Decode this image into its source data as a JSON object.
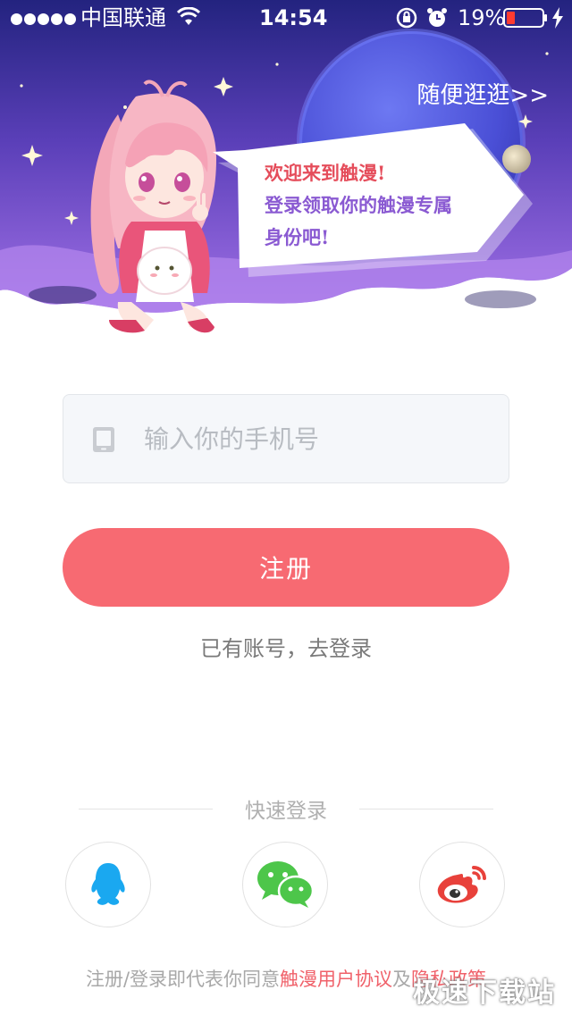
{
  "status_bar": {
    "carrier": "中国联通",
    "time": "14:54",
    "battery": "19%"
  },
  "header": {
    "browse_link": "随便逛逛>>",
    "welcome_lines": [
      "欢迎来到触漫!",
      "登录领取你的触漫专属",
      "身份吧!"
    ]
  },
  "form": {
    "phone_placeholder": "输入你的手机号",
    "phone_value": "",
    "register_label": "注册",
    "login_link": "已有账号，去登录"
  },
  "quick_login": {
    "title": "快速登录",
    "providers": [
      {
        "name": "QQ",
        "icon": "qq-icon"
      },
      {
        "name": "WeChat",
        "icon": "wechat-icon"
      },
      {
        "name": "Weibo",
        "icon": "weibo-icon"
      }
    ]
  },
  "agreement": {
    "prefix": "注册/登录即代表你同意",
    "terms": "触漫用户协议",
    "and": "及",
    "privacy": "隐私政策"
  },
  "watermark": "极速下载站",
  "colors": {
    "header_top": "#2a2a8a",
    "header_bottom": "#9a6ae0",
    "primary_button": "#f76a72",
    "link_red": "#f0616a",
    "qq_blue": "#1aa8f0",
    "wechat_green": "#4dc64a",
    "weibo_red": "#e8413b"
  }
}
